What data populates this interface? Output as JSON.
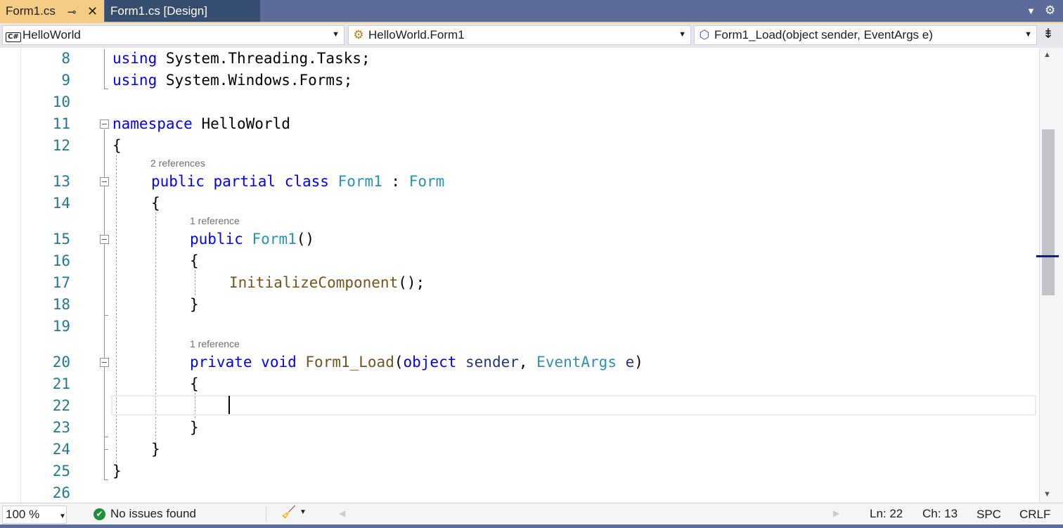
{
  "tabs": [
    {
      "label": "Form1.cs",
      "active": true,
      "pin_icon": "pin-icon",
      "close_icon": "close-icon"
    },
    {
      "label": "Form1.cs [Design]",
      "active": false
    }
  ],
  "tab_actions": {
    "overflow_icon": "chevron-down-icon",
    "settings_icon": "gear-icon"
  },
  "navigation": {
    "project": {
      "icon": "csharp-project-icon",
      "icon_text": "C#",
      "label": "HelloWorld"
    },
    "type": {
      "icon": "class-icon",
      "label": "HelloWorld.Form1"
    },
    "member": {
      "icon": "private-method-icon",
      "label": "Form1_Load(object sender, EventArgs e)"
    },
    "split_icon": "split-editor-icon"
  },
  "editor": {
    "line_numbers": [
      "8",
      "9",
      "10",
      "11",
      "12",
      "13",
      "14",
      "15",
      "16",
      "17",
      "18",
      "19",
      "20",
      "21",
      "22",
      "23",
      "24",
      "25",
      "26"
    ],
    "code_lens": [
      "2 references",
      "1 reference",
      "1 reference"
    ],
    "lines": {
      "l8": {
        "kw": "using",
        "rest": " System.Threading.Tasks;"
      },
      "l9": {
        "kw": "using",
        "rest": " System.Windows.Forms;"
      },
      "l11": {
        "kw": "namespace",
        "rest": " HelloWorld"
      },
      "l12": "{",
      "l13": {
        "kw1": "public",
        "kw2": "partial",
        "kw3": "class",
        "type": "Form1",
        "sep": " : ",
        "base": "Form"
      },
      "l14": "{",
      "l15": {
        "kw": "public",
        "type": "Form1",
        "rest": "()"
      },
      "l16": "{",
      "l17": {
        "fn": "InitializeComponent",
        "rest": "();"
      },
      "l18": "}",
      "l20": {
        "kw1": "private",
        "kw2": "void",
        "fn": "Form1_Load",
        "open": "(",
        "kw3": "object",
        "p1": "sender",
        "comma": ", ",
        "type": "EventArgs",
        "p2": "e",
        "close": ")"
      },
      "l21": "{",
      "l23": "}",
      "l24": "}",
      "l25": "}"
    },
    "current_line": "22",
    "colors": {
      "keyword": "#0000ff",
      "type": "#2b91af",
      "method": "#74531f",
      "parameter": "#1f377f",
      "line_number": "#237893"
    }
  },
  "scrollbar": {
    "up_icon": "scroll-up-icon",
    "down_icon": "scroll-down-icon"
  },
  "status": {
    "zoom": "100 %",
    "issues": "No issues found",
    "issues_icon": "check-circle-icon",
    "cleanup_icon": "code-cleanup-icon",
    "line": "Ln: 22",
    "column": "Ch: 13",
    "whitespace": "SPC",
    "line_ending": "CRLF"
  }
}
